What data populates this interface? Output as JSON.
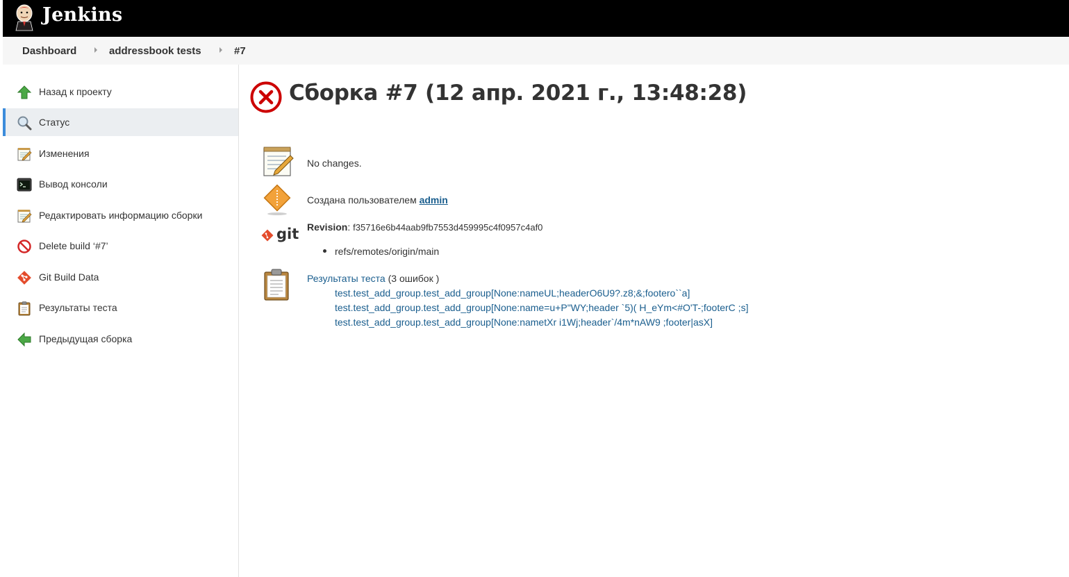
{
  "header": {
    "brand": "Jenkins"
  },
  "breadcrumb": {
    "items": [
      "Dashboard",
      "addressbook tests",
      "#7"
    ]
  },
  "sidebar": {
    "items": [
      {
        "label": "Назад к проекту",
        "icon": "up-arrow-icon"
      },
      {
        "label": "Статус",
        "icon": "magnifier-icon",
        "active": true
      },
      {
        "label": "Изменения",
        "icon": "notepad-icon"
      },
      {
        "label": "Вывод консоли",
        "icon": "terminal-icon"
      },
      {
        "label": "Редактировать информацию сборки",
        "icon": "notepad-edit-icon"
      },
      {
        "label": "Delete build ‘#7’",
        "icon": "no-entry-icon"
      },
      {
        "label": "Git Build Data",
        "icon": "git-icon"
      },
      {
        "label": "Результаты теста",
        "icon": "clipboard-icon"
      },
      {
        "label": "Предыдущая сборка",
        "icon": "left-arrow-icon"
      }
    ]
  },
  "build": {
    "title": "Сборка #7 (12 апр. 2021 г., 13:48:28)",
    "status_icon": "failed-icon",
    "status_color": "#cc0000"
  },
  "changes": {
    "text": "No changes."
  },
  "cause": {
    "prefix": "Создана пользователем",
    "user": "admin"
  },
  "git": {
    "logo_text": "git",
    "revision_label": "Revision",
    "revision": "f35716e6b44aab9fb7553d459995c4f0957c4af0",
    "branches": [
      "refs/remotes/origin/main"
    ]
  },
  "tests": {
    "link_label": "Результаты теста",
    "summary": "(3 ошибок )",
    "failures": [
      "test.test_add_group.test_add_group[None:nameUL;headerO6U9?.z8;&;footero``a]",
      "test.test_add_group.test_add_group[None:name=u+P\"WY;header `5)( H_eYm<#O'T-;footerC ;s]",
      "test.test_add_group.test_add_group[None:nametXr i1Wj;header`/4m*nAW9 ;footer|asX]"
    ]
  },
  "colors": {
    "link": "#1a5e8e",
    "active_bar": "#3c8cdb",
    "header_bg": "#000000"
  }
}
